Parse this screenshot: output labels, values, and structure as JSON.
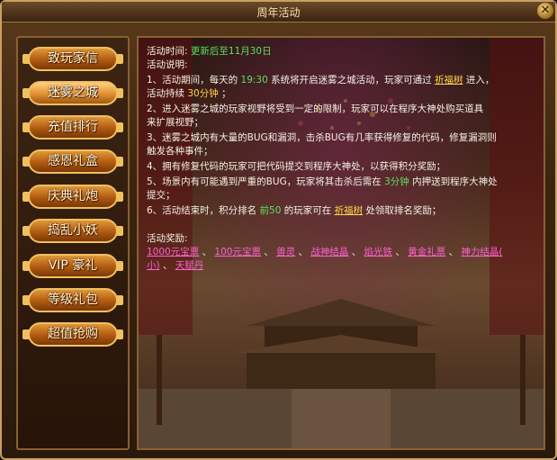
{
  "window": {
    "title": "周年活动",
    "close_label": "✕"
  },
  "sidebar": {
    "items": [
      {
        "label": "致玩家信",
        "active": false
      },
      {
        "label": "迷雾之城",
        "active": true
      },
      {
        "label": "充值排行",
        "active": false
      },
      {
        "label": "感恩礼盒",
        "active": false
      },
      {
        "label": "庆典礼炮",
        "active": false
      },
      {
        "label": "捣乱小妖",
        "active": false
      },
      {
        "label": "VIP 豪礼",
        "active": false
      },
      {
        "label": "等级礼包",
        "active": false
      },
      {
        "label": "超值抢购",
        "active": false
      }
    ]
  },
  "content": {
    "time_label": "活动时间:",
    "time_value": "更新后至11月30日",
    "desc_label": "活动说明:",
    "r1a": "1、活动期间，每天的",
    "r1_time": "19:30",
    "r1b": "系统将开启迷雾之城活动，玩家可通过",
    "r1_link": "祈福树",
    "r1c": "进入，",
    "r2a": "活动持续",
    "r2_dur": "30分钟",
    "r2b": "；",
    "r3": "2、进入迷雾之城的玩家视野将受到一定的限制，玩家可以在程序大神处购买道具",
    "r4": "来扩展视野；",
    "r5": "3、迷雾之城内有大量的BUG和漏洞，击杀BUG有几率获得修复的代码，修复漏洞则",
    "r6": "触发各种事件；",
    "r7": "4、拥有修复代码的玩家可把代码提交到程序大神处，以获得积分奖励；",
    "r8a": "5、场景内有可能遇到严重的BUG，玩家将其击杀后需在",
    "r8_dur": "3分钟",
    "r8b": "内押送到程序大神处",
    "r9": "提交；",
    "r10a": "6、活动结束时，积分排名",
    "r10_rank": "前50",
    "r10b": "的玩家可在",
    "r10_link": "祈福树",
    "r10c": "处领取排名奖励；",
    "reward_label": "活动奖励:",
    "rewards_line1": [
      "1000元宝票",
      "100元宝票",
      "兽灵",
      "战神结晶",
      "焰光铁",
      "黄金礼票",
      "神力结晶("
    ],
    "rewards_line2": [
      "小)",
      "天赋丹"
    ],
    "separator": "、"
  },
  "colors": {
    "button_gold": "#e09838",
    "highlight_green": "#60e060",
    "highlight_yellow": "#ffd64a",
    "item_pink": "#ff60d0"
  }
}
